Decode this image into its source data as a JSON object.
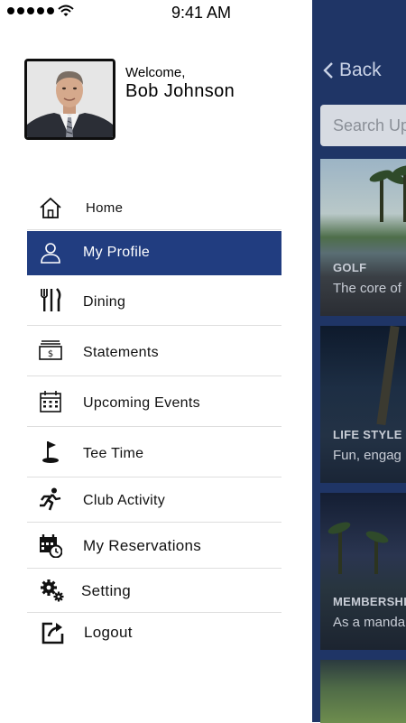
{
  "status_bar": {
    "time": "9:41 AM"
  },
  "profile": {
    "welcome": "Welcome,",
    "name": "Bob Johnson"
  },
  "menu": {
    "items": [
      {
        "label": "Home",
        "icon": "home-icon"
      },
      {
        "label": "My Profile",
        "icon": "user-icon",
        "active": true
      },
      {
        "label": "Dining",
        "icon": "dining-icon"
      },
      {
        "label": "Statements",
        "icon": "statement-icon"
      },
      {
        "label": "Upcoming Events",
        "icon": "calendar-icon"
      },
      {
        "label": "Tee Time",
        "icon": "golf-flag-icon"
      },
      {
        "label": "Club Activity",
        "icon": "running-icon"
      },
      {
        "label": "My Reservations",
        "icon": "reservation-calendar-icon"
      },
      {
        "label": "Setting",
        "icon": "gears-icon"
      },
      {
        "label": "Logout",
        "icon": "logout-icon"
      }
    ]
  },
  "background": {
    "back_label": "Back",
    "search_placeholder": "Search Up",
    "cards": [
      {
        "category": "GOLF",
        "description": "The core of"
      },
      {
        "category": "LIFE STYLE",
        "description": "Fun, engag"
      },
      {
        "category": "MEMBERSHI",
        "description": "As a manda"
      }
    ]
  },
  "colors": {
    "active_bg": "#213d80",
    "background_panel": "#1f3566"
  }
}
